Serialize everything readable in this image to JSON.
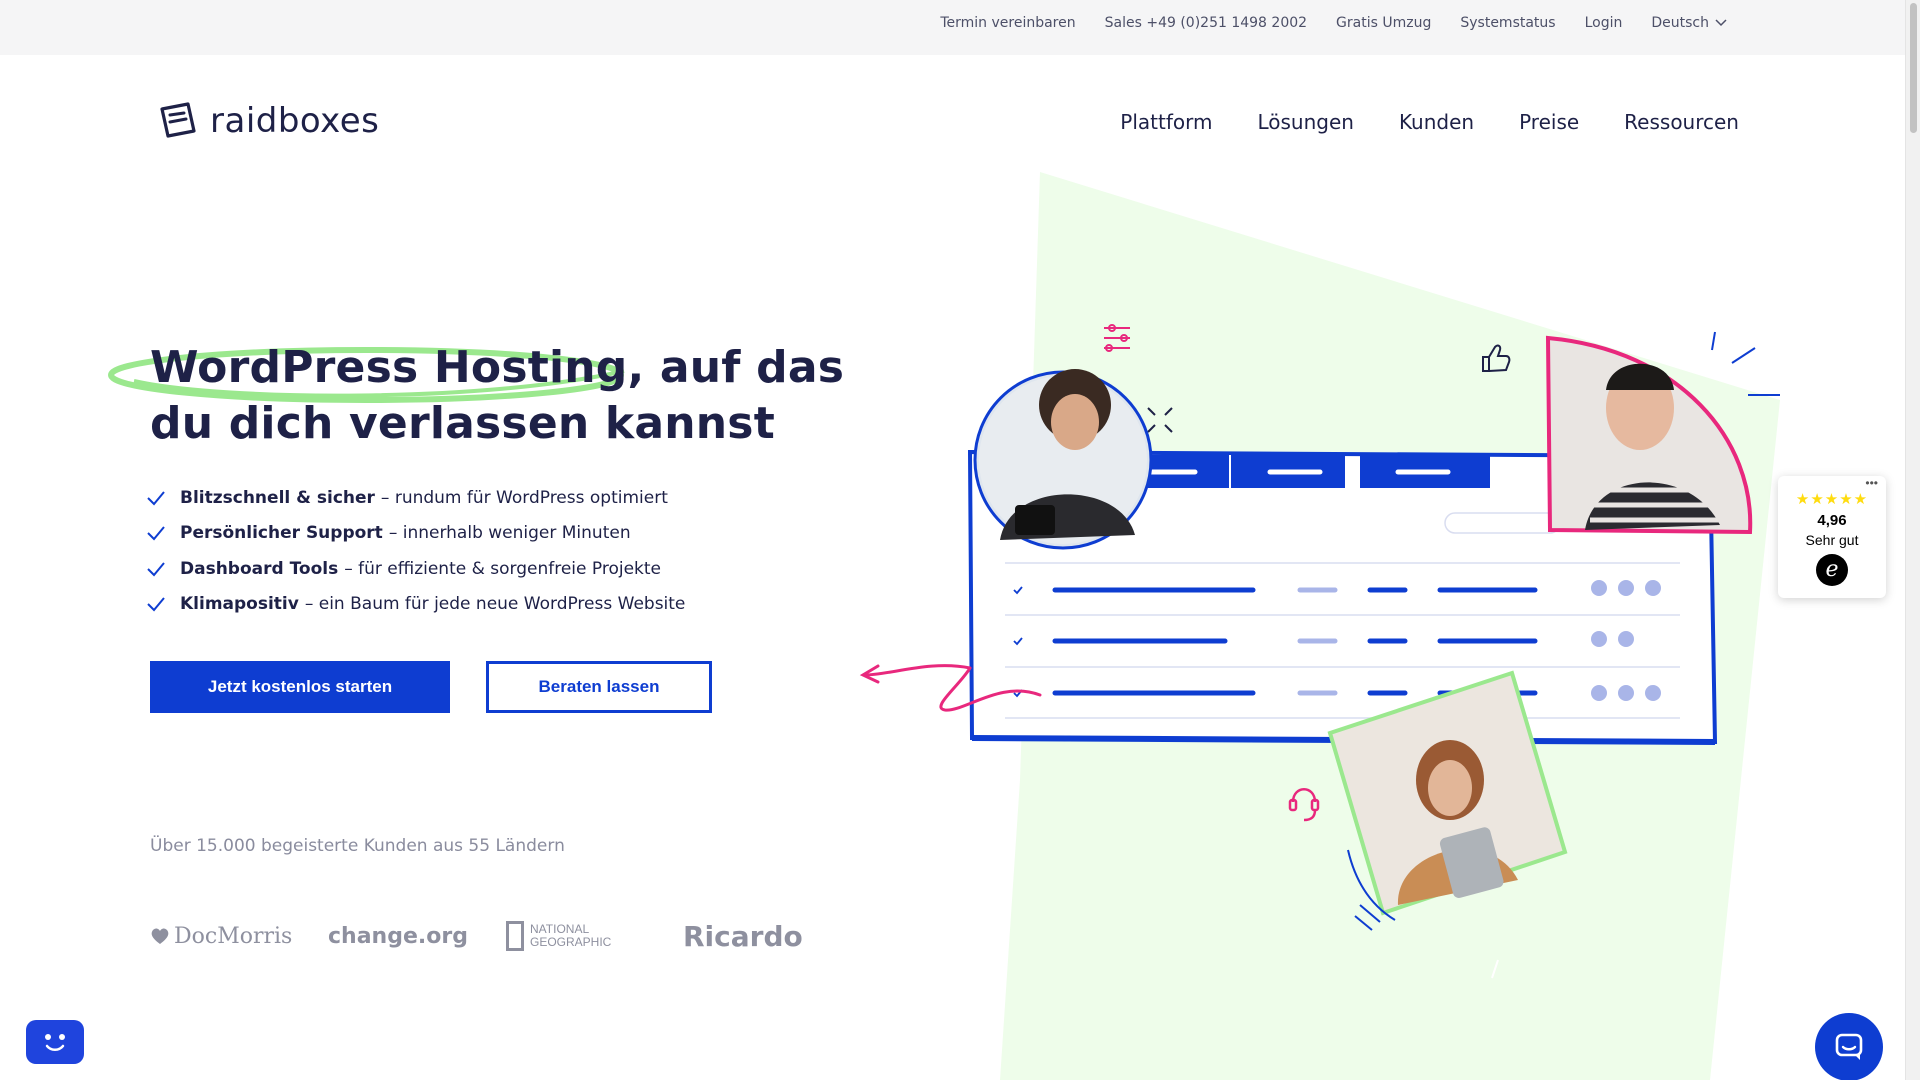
{
  "topbar": {
    "links": [
      "Termin vereinbaren",
      "Sales +49 (0)251 1498 2002",
      "Gratis Umzug",
      "Systemstatus",
      "Login"
    ],
    "language": "Deutsch"
  },
  "header": {
    "logo_text": "raidboxes",
    "nav": [
      "Plattform",
      "Lösungen",
      "Kunden",
      "Preise",
      "Ressourcen"
    ]
  },
  "hero": {
    "title_line1": "WordPress Hosting, auf das",
    "title_line2": "du dich verlassen kannst",
    "features": [
      {
        "bold": "Blitzschnell & sicher",
        "text": "– rundum für WordPress optimiert"
      },
      {
        "bold": "Persönlicher Support",
        "text": "– innerhalb weniger Minuten"
      },
      {
        "bold": "Dashboard Tools",
        "text": "– für effiziente & sorgenfreie Projekte"
      },
      {
        "bold": "Klimapositiv",
        "text": "– ein Baum für jede neue WordPress Website"
      }
    ],
    "primary_button": "Jetzt kostenlos starten",
    "secondary_button": "Beraten lassen"
  },
  "customers": {
    "text": "Über 15.000 begeisterte Kunden aus 55 Ländern",
    "logos": {
      "docmorris": "DocMorris",
      "change": "change.org",
      "natgeo_line1": "NATIONAL",
      "natgeo_line2": "GEOGRAPHIC",
      "ricardo": "Ricardo"
    }
  },
  "review": {
    "stars": "★★★★★",
    "score": "4,96",
    "label": "Sehr gut",
    "badge": "e"
  },
  "colors": {
    "brand_blue": "#0e3dd1",
    "navy": "#1e2147",
    "accent_pink": "#e8287d",
    "accent_green": "#9be88e",
    "light_green": "#eefdea"
  },
  "icons": [
    "check-icon",
    "chevron-down-icon",
    "sliders-icon",
    "thumbs-up-icon",
    "headset-icon",
    "chat-bot-icon",
    "chat-icon"
  ]
}
